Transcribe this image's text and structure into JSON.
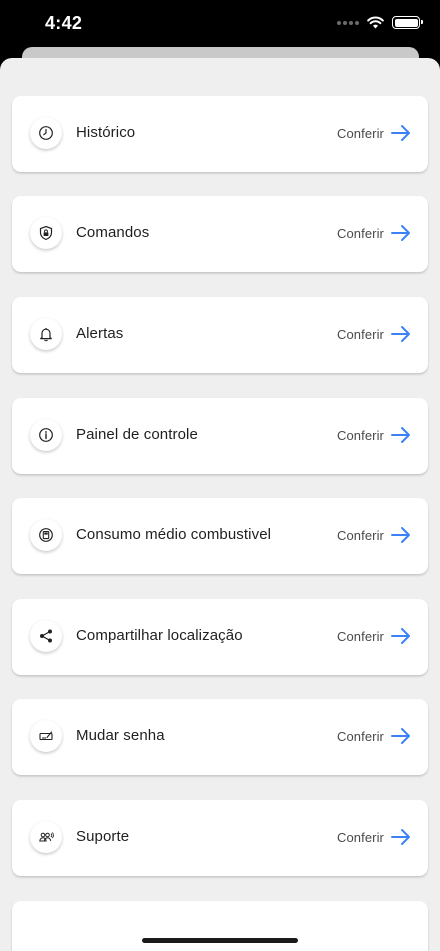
{
  "status_bar": {
    "time": "4:42"
  },
  "colors": {
    "accent": "#3b82f6",
    "background": "#efefef",
    "card": "#ffffff"
  },
  "menu": {
    "items": [
      {
        "label": "Histórico",
        "action": "Conferir",
        "icon": "clock-icon"
      },
      {
        "label": "Comandos",
        "action": "Conferir",
        "icon": "lock-shield-icon"
      },
      {
        "label": "Alertas",
        "action": "Conferir",
        "icon": "bell-icon"
      },
      {
        "label": "Painel de controle",
        "action": "Conferir",
        "icon": "gauge-icon"
      },
      {
        "label": "Consumo médio combustivel",
        "action": "Conferir",
        "icon": "fuel-icon"
      },
      {
        "label": "Compartilhar localização",
        "action": "Conferir",
        "icon": "share-icon"
      },
      {
        "label": "Mudar senha",
        "action": "Conferir",
        "icon": "password-icon"
      },
      {
        "label": "Suporte",
        "action": "Conferir",
        "icon": "support-icon"
      }
    ]
  }
}
